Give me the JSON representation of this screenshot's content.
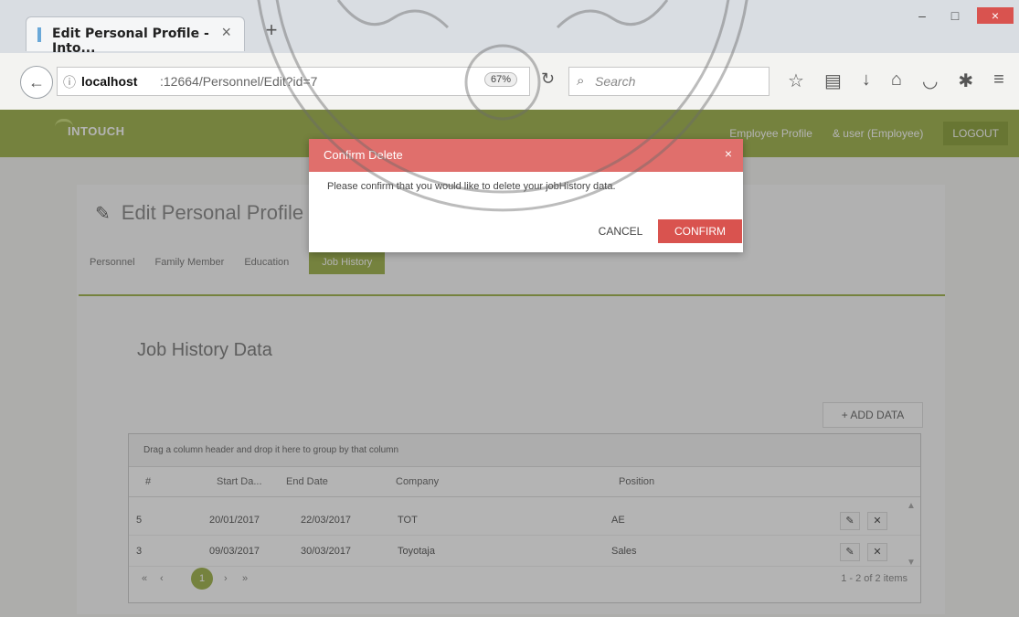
{
  "browser": {
    "tab_title": "Edit Personal Profile - Into...",
    "tab_close": "×",
    "new_tab": "+",
    "url_host": "localhost",
    "url_path": ":12664/Personnel/Edit?id=7",
    "zoom": "67%",
    "search_placeholder": "Search",
    "window_buttons": [
      "–",
      "□",
      "×"
    ]
  },
  "app": {
    "logo": "INTOUCH",
    "nav_items": [
      "Employee Profile",
      "& user (Employee)"
    ],
    "logout": "LOGOUT",
    "colors": {
      "brand": "#9eb24a",
      "danger": "#d9534f"
    }
  },
  "page": {
    "title": "Edit Personal Profile",
    "tabs": [
      "Personnel",
      "Family Member",
      "Education"
    ],
    "active_tab": "Job History",
    "section_title": "Job History Data",
    "add_button": "+ ADD DATA"
  },
  "grid": {
    "group_hint": "Drag a column header and drop it here to group by that column",
    "columns": [
      "#",
      "Start Da...",
      "End Date",
      "Company",
      "Position"
    ],
    "rows": [
      {
        "id": "5",
        "start": "20/01/2017",
        "end": "22/03/2017",
        "company": "TOT",
        "position": "AE"
      },
      {
        "id": "3",
        "start": "09/03/2017",
        "end": "30/03/2017",
        "company": "Toyotaja",
        "position": "Sales"
      }
    ],
    "pager": {
      "first": "«",
      "prev": "‹",
      "current": "1",
      "next": "›",
      "last": "»",
      "info": "1 - 2 of 2 items"
    }
  },
  "modal": {
    "title": "Confirm Delete",
    "close": "×",
    "message": "Please confirm that you would like to delete your jobHistory data.",
    "cancel": "CANCEL",
    "confirm": "CONFIRM"
  }
}
